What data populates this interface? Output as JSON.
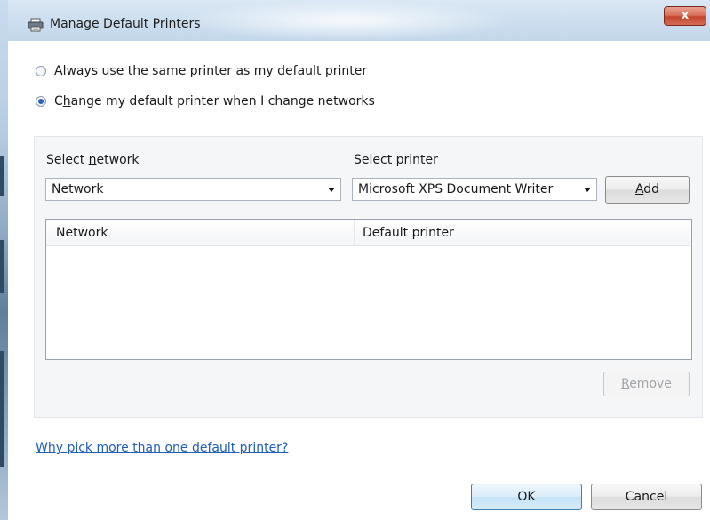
{
  "window": {
    "title": "Manage Default Printers",
    "close_label": "x"
  },
  "options": {
    "always_same": {
      "label_pre": "Al",
      "label_acc": "w",
      "label_post": "ays use the same printer as my default printer",
      "checked": false
    },
    "change_on_network": {
      "label_pre": "C",
      "label_acc": "h",
      "label_post": "ange my default printer when I change networks",
      "checked": true
    }
  },
  "network_select": {
    "label_pre": "Select ",
    "label_acc": "n",
    "label_post": "etwork",
    "value": "Network"
  },
  "printer_select": {
    "label": "Select printer",
    "value": "Microsoft XPS Document Writer"
  },
  "add_button": {
    "label_acc": "A",
    "label_post": "dd"
  },
  "table": {
    "columns": [
      "Network",
      "Default printer"
    ],
    "rows": []
  },
  "remove_button": {
    "label_acc": "R",
    "label_post": "emove",
    "enabled": false
  },
  "help_link": "Why pick more than one default printer?",
  "footer": {
    "ok_label": "OK",
    "cancel_label": "Cancel"
  },
  "colors": {
    "link": "#1f5fb5",
    "radio_selected": "#2a62b8",
    "close_button": "#c4452c"
  },
  "icons": {
    "title": "printer-icon",
    "combo_arrow": "chevron-down-icon",
    "close": "close-icon"
  }
}
